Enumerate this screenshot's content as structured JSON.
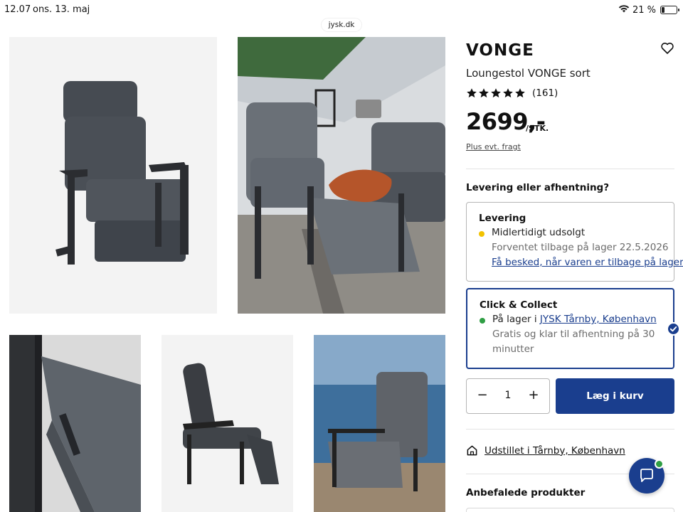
{
  "status_bar": {
    "time": "12.07",
    "date": "ons. 13. maj",
    "battery": "21 %",
    "url": "jysk.dk"
  },
  "product": {
    "brand": "VONGE",
    "subtitle": "Loungestol VONGE sort",
    "rating_stars": 5,
    "rating_count": "(161)",
    "price": "2699,-",
    "price_unit": "/STK.",
    "shipping_note": "Plus evt. fragt"
  },
  "delivery": {
    "question": "Levering eller afhentning?",
    "levering": {
      "title": "Levering",
      "status": "Midlertidigt udsolgt",
      "status_color": "#f2c200",
      "expected": "Forventet tilbage på lager 22.5.2026",
      "notify_link": "Få besked, når varen er tilbage på lager"
    },
    "click_collect": {
      "title": "Click & Collect",
      "stock_prefix": "På lager i ",
      "store_link": "JYSK Tårnby, København",
      "status_color": "#2f9e44",
      "pickup_line1": "Gratis og klar til afhentning på 30",
      "pickup_line2": "minutter",
      "selected": true
    }
  },
  "cart": {
    "minus": "−",
    "quantity": "1",
    "plus": "+",
    "add_label": "Læg i kurv"
  },
  "showroom": {
    "prefix": "Udstillet i ",
    "store": "Tårnby, København"
  },
  "recommended": {
    "title": "Anbefalede produkter"
  },
  "colors": {
    "accent": "#1a3e8e",
    "in_stock": "#2f9e44",
    "out_of_stock": "#f2c200"
  },
  "icons": [
    "wifi-icon",
    "battery-icon",
    "heart-icon",
    "star-icon",
    "check-icon",
    "house-icon",
    "chat-icon"
  ]
}
